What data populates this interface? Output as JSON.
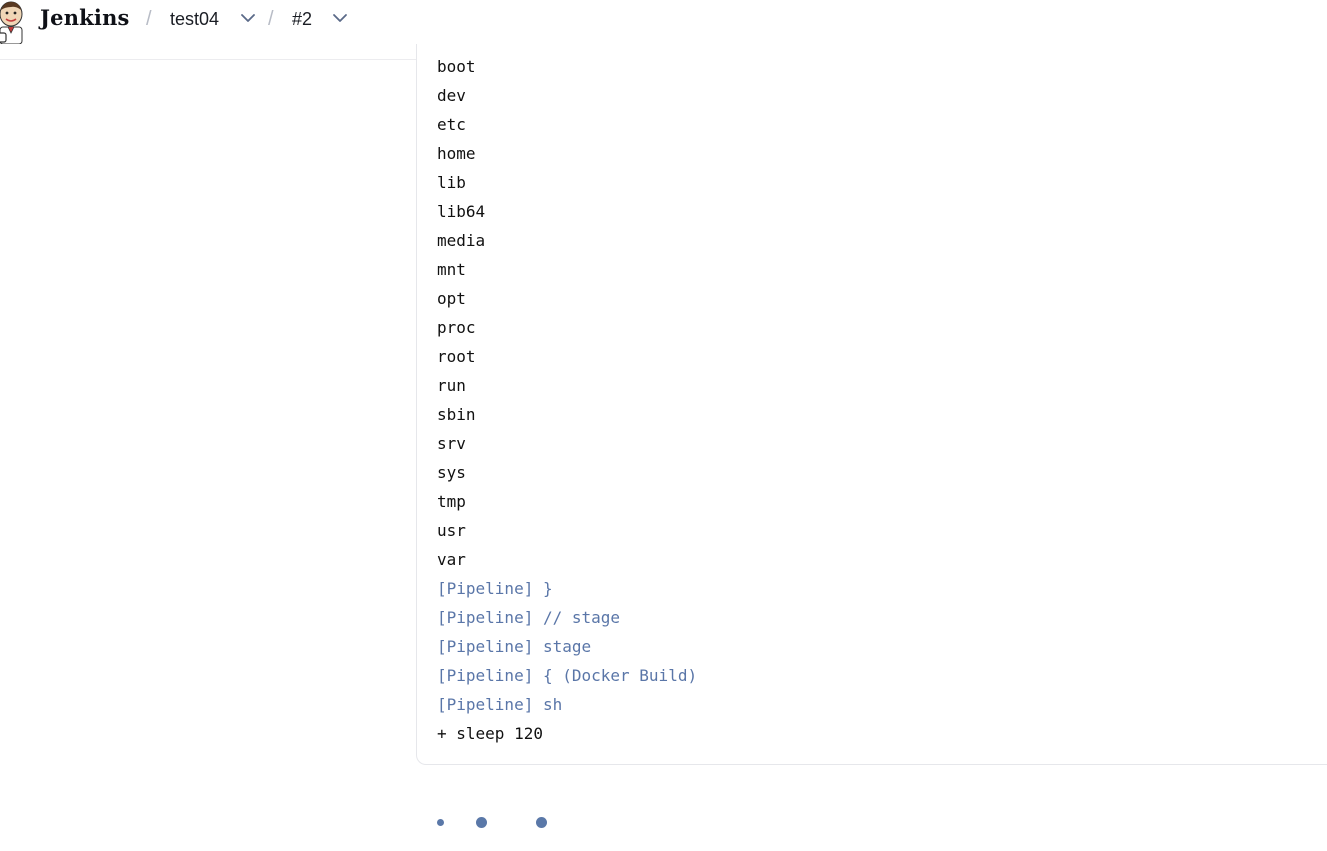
{
  "header": {
    "brand": "Jenkins",
    "breadcrumbs": [
      {
        "label": "test04"
      },
      {
        "label": "#2"
      }
    ],
    "separator": "/"
  },
  "console": {
    "lines": [
      {
        "text": "boot",
        "kind": "output"
      },
      {
        "text": "dev",
        "kind": "output"
      },
      {
        "text": "etc",
        "kind": "output"
      },
      {
        "text": "home",
        "kind": "output"
      },
      {
        "text": "lib",
        "kind": "output"
      },
      {
        "text": "lib64",
        "kind": "output"
      },
      {
        "text": "media",
        "kind": "output"
      },
      {
        "text": "mnt",
        "kind": "output"
      },
      {
        "text": "opt",
        "kind": "output"
      },
      {
        "text": "proc",
        "kind": "output"
      },
      {
        "text": "root",
        "kind": "output"
      },
      {
        "text": "run",
        "kind": "output"
      },
      {
        "text": "sbin",
        "kind": "output"
      },
      {
        "text": "srv",
        "kind": "output"
      },
      {
        "text": "sys",
        "kind": "output"
      },
      {
        "text": "tmp",
        "kind": "output"
      },
      {
        "text": "usr",
        "kind": "output"
      },
      {
        "text": "var",
        "kind": "output"
      },
      {
        "text": "[Pipeline] }",
        "kind": "pipeline"
      },
      {
        "text": "[Pipeline] // stage",
        "kind": "pipeline"
      },
      {
        "text": "[Pipeline] stage",
        "kind": "pipeline"
      },
      {
        "text": "[Pipeline] { (Docker Build)",
        "kind": "pipeline"
      },
      {
        "text": "[Pipeline] sh",
        "kind": "pipeline"
      },
      {
        "text": "+ sleep 120",
        "kind": "output"
      }
    ]
  },
  "colors": {
    "pipeline_text": "#5a76a8",
    "output_text": "#111111",
    "spinner": "#5a78a8"
  },
  "icons": {
    "logo": "jenkins-butler-logo",
    "dropdown": "chevron-down-icon",
    "loading": "loading-dots-icon"
  }
}
